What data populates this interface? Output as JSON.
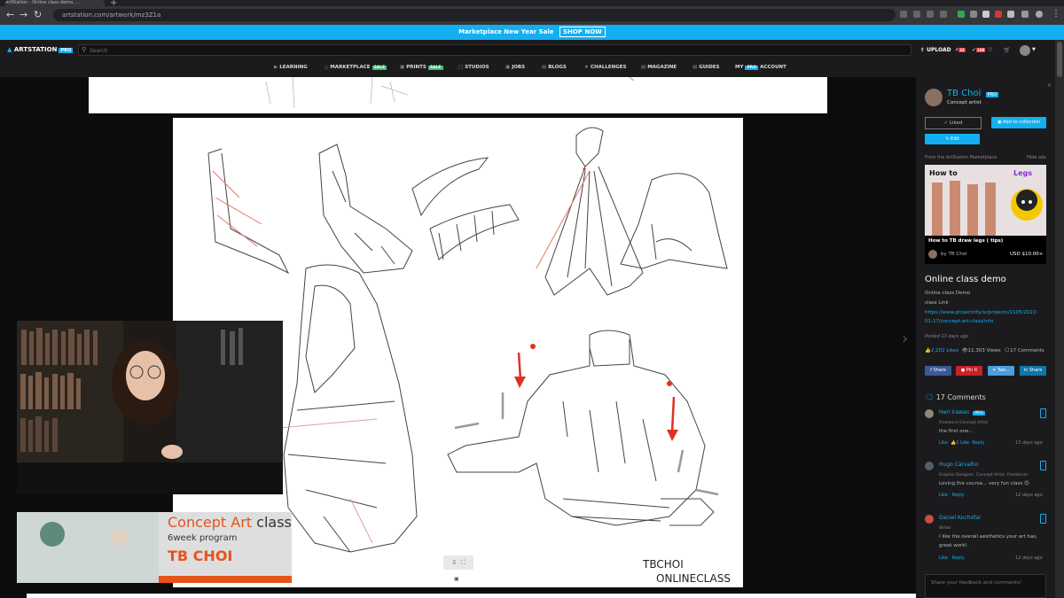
{
  "browser": {
    "tab_title": "ArtStation - Online class demo, ...",
    "url": "artstation.com/artwork/mz3Z1a"
  },
  "banner": {
    "text": "Marketplace New Year Sale",
    "cta": "SHOP NOW"
  },
  "topbar": {
    "logo": "ARTSTATION",
    "logo_badge": "PRO",
    "search_placeholder": "Search",
    "upload": "UPLOAD",
    "notif_count": "32",
    "msg_count": "100"
  },
  "nav": {
    "learning": "LEARNING",
    "marketplace": "MARKETPLACE",
    "sale_badge": "SALE",
    "prints": "PRINTS",
    "studios": "STUDIOS",
    "jobs": "JOBS",
    "blogs": "BLOGS",
    "challenges": "CHALLENGES",
    "magazine": "MAGAZINE",
    "guides": "GUIDES",
    "my": "MY",
    "pro": "PRO",
    "account": "ACCOUNT"
  },
  "artwork": {
    "signature_1": "TBCHOI",
    "signature_2": "ONLINECLASS"
  },
  "promo": {
    "title_1": "Concept Art",
    "title_2": " class",
    "subtitle": "6week program",
    "name": "TB CHOI"
  },
  "sidebar": {
    "author": "TB Choi",
    "author_badge": "PRO",
    "author_role": "Concept artist",
    "liked": "Liked",
    "add_collection": "Add to collection",
    "edit": "Edit",
    "marketplace_label": "From the ArtStation Marketplace",
    "hide_ads": "Hide ads",
    "product_title": "How to TB draw legs ( tips)",
    "product_author": "by TB Choi",
    "product_price": "USD $10.00+",
    "product_img_text": "How to",
    "product_img_text2": "Legs",
    "artwork_title": "Online class demo",
    "desc_1": "Online class Demo",
    "desc_2": "class Link",
    "link_1": "https://www.projectcity.tv/projects/1105/2022-",
    "link_2": "01-17/concept-art-class/info",
    "posted": "Posted 13 days ago",
    "likes": "2,202 Likes",
    "views": "11,303 Views",
    "comments_count": "17 Comments",
    "share_fb": "Share",
    "share_pin": "Pin it",
    "share_tw": "Twe...",
    "share_in": "Share",
    "comments_heading": "17 Comments",
    "comments": [
      {
        "name": "Heri Irawan",
        "badge": "PRO",
        "role": "Freelance Concept Artist",
        "text": "the first one...",
        "like": "Like",
        "likes": "1 Like",
        "reply": "Reply",
        "time": "13 days ago"
      },
      {
        "name": "Hugo Carvalho",
        "badge": "",
        "role": "Graphic Designer, Concept Artist, Freelancer",
        "text": "Loving the course... very fun class 😊",
        "like": "Like",
        "likes": "",
        "reply": "Reply",
        "time": "12 days ago"
      },
      {
        "name": "Daniel Kochofar",
        "badge": "",
        "role": "Writer",
        "text": "I like the overall aesthetics your art has,",
        "text2": "great work!.",
        "like": "Like",
        "likes": "",
        "reply": "Reply",
        "time": "12 days ago"
      }
    ],
    "comment_placeholder": "Share your feedback and comments!"
  },
  "colors": {
    "accent": "#13aff0",
    "sale": "#3ac06e",
    "promo": "#e8531a"
  }
}
